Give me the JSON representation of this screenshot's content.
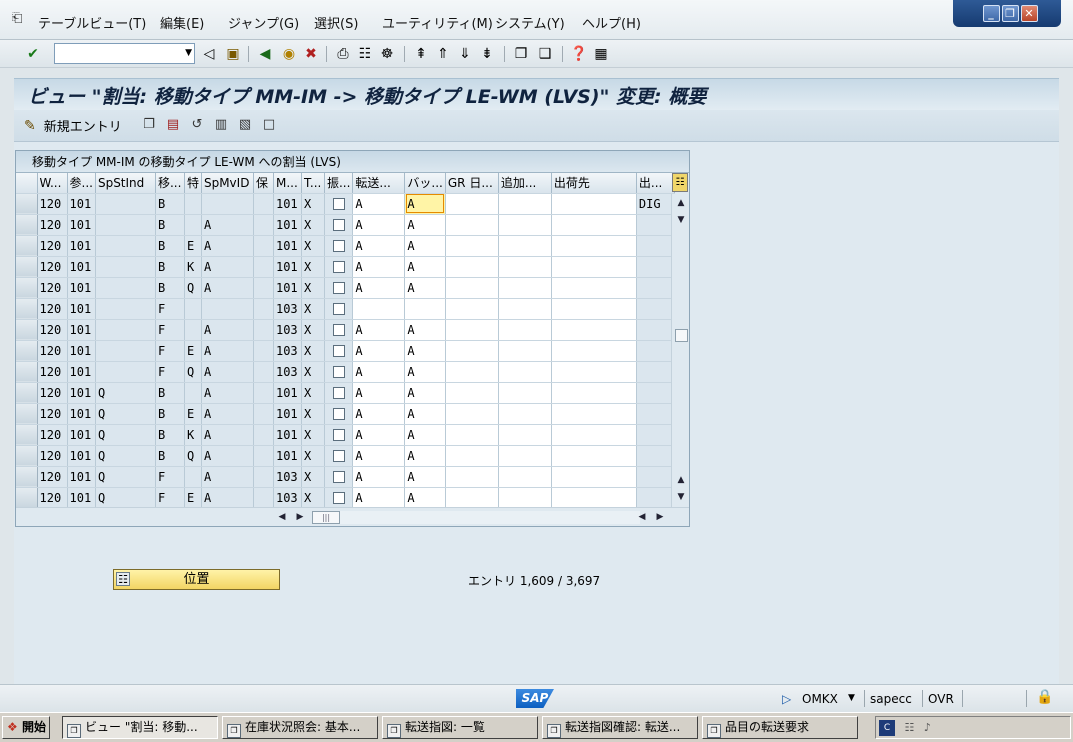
{
  "menu": [
    "テーブルビュー(T)",
    "編集(E)",
    "ジャンプ(G)",
    "選択(S)",
    "ユーティリティ(M)",
    "システム(Y)",
    "ヘルプ(H)"
  ],
  "command_field": {
    "value": ""
  },
  "title": "ビュー \"割当: 移動タイプ MM-IM -> 移動タイプ LE-WM (LVS)\" 変更: 概要",
  "app_toolbar": {
    "new_entry_label": "新規エントリ"
  },
  "table": {
    "title": "移動タイプ MM-IM の移動タイプ LE-WM への割当 (LVS)",
    "columns": [
      "W...",
      "参...",
      "SpStInd",
      "移...",
      "特",
      "SpMvID",
      "保",
      "M...",
      "T...",
      "振...",
      "転送...",
      "バッ...",
      "GR 日...",
      "追加...",
      "出荷先",
      "出..."
    ],
    "rows": [
      [
        "120",
        "101",
        "",
        "B",
        "",
        "",
        "",
        "101",
        "X",
        false,
        "A",
        "A",
        "",
        "",
        "",
        "DIG"
      ],
      [
        "120",
        "101",
        "",
        "B",
        "",
        "A",
        "",
        "101",
        "X",
        false,
        "A",
        "A",
        "",
        "",
        "",
        ""
      ],
      [
        "120",
        "101",
        "",
        "B",
        "E",
        "A",
        "",
        "101",
        "X",
        false,
        "A",
        "A",
        "",
        "",
        "",
        ""
      ],
      [
        "120",
        "101",
        "",
        "B",
        "K",
        "A",
        "",
        "101",
        "X",
        false,
        "A",
        "A",
        "",
        "",
        "",
        ""
      ],
      [
        "120",
        "101",
        "",
        "B",
        "Q",
        "A",
        "",
        "101",
        "X",
        false,
        "A",
        "A",
        "",
        "",
        "",
        ""
      ],
      [
        "120",
        "101",
        "",
        "F",
        "",
        "",
        "",
        "103",
        "X",
        false,
        "",
        "",
        "",
        "",
        "",
        ""
      ],
      [
        "120",
        "101",
        "",
        "F",
        "",
        "A",
        "",
        "103",
        "X",
        false,
        "A",
        "A",
        "",
        "",
        "",
        ""
      ],
      [
        "120",
        "101",
        "",
        "F",
        "E",
        "A",
        "",
        "103",
        "X",
        false,
        "A",
        "A",
        "",
        "",
        "",
        ""
      ],
      [
        "120",
        "101",
        "",
        "F",
        "Q",
        "A",
        "",
        "103",
        "X",
        false,
        "A",
        "A",
        "",
        "",
        "",
        ""
      ],
      [
        "120",
        "101",
        "Q",
        "B",
        "",
        "A",
        "",
        "101",
        "X",
        false,
        "A",
        "A",
        "",
        "",
        "",
        ""
      ],
      [
        "120",
        "101",
        "Q",
        "B",
        "E",
        "A",
        "",
        "101",
        "X",
        false,
        "A",
        "A",
        "",
        "",
        "",
        ""
      ],
      [
        "120",
        "101",
        "Q",
        "B",
        "K",
        "A",
        "",
        "101",
        "X",
        false,
        "A",
        "A",
        "",
        "",
        "",
        ""
      ],
      [
        "120",
        "101",
        "Q",
        "B",
        "Q",
        "A",
        "",
        "101",
        "X",
        false,
        "A",
        "A",
        "",
        "",
        "",
        ""
      ],
      [
        "120",
        "101",
        "Q",
        "F",
        "",
        "A",
        "",
        "103",
        "X",
        false,
        "A",
        "A",
        "",
        "",
        "",
        ""
      ],
      [
        "120",
        "101",
        "Q",
        "F",
        "E",
        "A",
        "",
        "103",
        "X",
        false,
        "A",
        "A",
        "",
        "",
        "",
        ""
      ]
    ]
  },
  "position_button": {
    "label": "位置"
  },
  "entries_text": "エントリ 1,609 / 3,697",
  "status": {
    "system": "OMKX",
    "server": "sapecc",
    "mode": "OVR"
  },
  "taskbar": {
    "start": "開始",
    "tasks": [
      "ビュー \"割当: 移動...",
      "在庫状況照会: 基本...",
      "転送指図: 一覧",
      "転送指図確認: 転送...",
      "品目の転送要求"
    ]
  },
  "colors": {
    "title_bg": "#c7d9e6",
    "focus_cell": "#fff4a6",
    "position_button": "#f2d564"
  }
}
